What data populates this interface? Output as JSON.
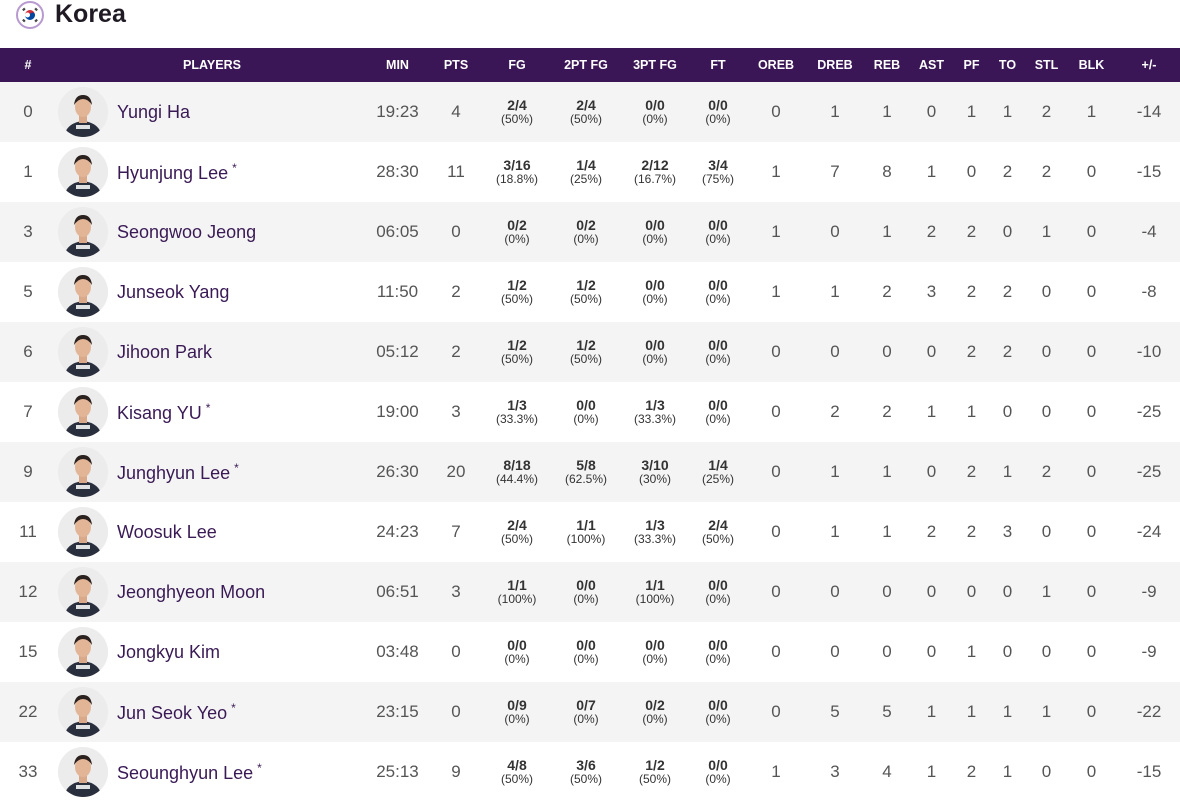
{
  "team": {
    "name": "Korea",
    "flag_icon": "korea-flag-icon"
  },
  "columns": [
    "#",
    "PLAYERS",
    "MIN",
    "PTS",
    "FG",
    "2PT FG",
    "3PT FG",
    "FT",
    "OREB",
    "DREB",
    "REB",
    "AST",
    "PF",
    "TO",
    "STL",
    "BLK",
    "+/-"
  ],
  "colors": {
    "header_bg": "#3b1656",
    "name_color": "#3a1a55",
    "row_alt": "#f4f4f4"
  },
  "players": [
    {
      "num": "0",
      "name": "Yungi Ha",
      "starter": false,
      "min": "19:23",
      "pts": "4",
      "fg": "2/4",
      "fg_pct": "(50%)",
      "fg2": "2/4",
      "fg2_pct": "(50%)",
      "fg3": "0/0",
      "fg3_pct": "(0%)",
      "ft": "0/0",
      "ft_pct": "(0%)",
      "oreb": "0",
      "dreb": "1",
      "reb": "1",
      "ast": "0",
      "pf": "1",
      "to": "1",
      "stl": "2",
      "blk": "1",
      "pm": "-14"
    },
    {
      "num": "1",
      "name": "Hyunjung Lee",
      "starter": true,
      "min": "28:30",
      "pts": "11",
      "fg": "3/16",
      "fg_pct": "(18.8%)",
      "fg2": "1/4",
      "fg2_pct": "(25%)",
      "fg3": "2/12",
      "fg3_pct": "(16.7%)",
      "ft": "3/4",
      "ft_pct": "(75%)",
      "oreb": "1",
      "dreb": "7",
      "reb": "8",
      "ast": "1",
      "pf": "0",
      "to": "2",
      "stl": "2",
      "blk": "0",
      "pm": "-15"
    },
    {
      "num": "3",
      "name": "Seongwoo Jeong",
      "starter": false,
      "min": "06:05",
      "pts": "0",
      "fg": "0/2",
      "fg_pct": "(0%)",
      "fg2": "0/2",
      "fg2_pct": "(0%)",
      "fg3": "0/0",
      "fg3_pct": "(0%)",
      "ft": "0/0",
      "ft_pct": "(0%)",
      "oreb": "1",
      "dreb": "0",
      "reb": "1",
      "ast": "2",
      "pf": "2",
      "to": "0",
      "stl": "1",
      "blk": "0",
      "pm": "-4"
    },
    {
      "num": "5",
      "name": "Junseok Yang",
      "starter": false,
      "min": "11:50",
      "pts": "2",
      "fg": "1/2",
      "fg_pct": "(50%)",
      "fg2": "1/2",
      "fg2_pct": "(50%)",
      "fg3": "0/0",
      "fg3_pct": "(0%)",
      "ft": "0/0",
      "ft_pct": "(0%)",
      "oreb": "1",
      "dreb": "1",
      "reb": "2",
      "ast": "3",
      "pf": "2",
      "to": "2",
      "stl": "0",
      "blk": "0",
      "pm": "-8"
    },
    {
      "num": "6",
      "name": "Jihoon Park",
      "starter": false,
      "min": "05:12",
      "pts": "2",
      "fg": "1/2",
      "fg_pct": "(50%)",
      "fg2": "1/2",
      "fg2_pct": "(50%)",
      "fg3": "0/0",
      "fg3_pct": "(0%)",
      "ft": "0/0",
      "ft_pct": "(0%)",
      "oreb": "0",
      "dreb": "0",
      "reb": "0",
      "ast": "0",
      "pf": "2",
      "to": "2",
      "stl": "0",
      "blk": "0",
      "pm": "-10"
    },
    {
      "num": "7",
      "name": "Kisang YU",
      "starter": true,
      "min": "19:00",
      "pts": "3",
      "fg": "1/3",
      "fg_pct": "(33.3%)",
      "fg2": "0/0",
      "fg2_pct": "(0%)",
      "fg3": "1/3",
      "fg3_pct": "(33.3%)",
      "ft": "0/0",
      "ft_pct": "(0%)",
      "oreb": "0",
      "dreb": "2",
      "reb": "2",
      "ast": "1",
      "pf": "1",
      "to": "0",
      "stl": "0",
      "blk": "0",
      "pm": "-25"
    },
    {
      "num": "9",
      "name": "Junghyun Lee",
      "starter": true,
      "min": "26:30",
      "pts": "20",
      "fg": "8/18",
      "fg_pct": "(44.4%)",
      "fg2": "5/8",
      "fg2_pct": "(62.5%)",
      "fg3": "3/10",
      "fg3_pct": "(30%)",
      "ft": "1/4",
      "ft_pct": "(25%)",
      "oreb": "0",
      "dreb": "1",
      "reb": "1",
      "ast": "0",
      "pf": "2",
      "to": "1",
      "stl": "2",
      "blk": "0",
      "pm": "-25"
    },
    {
      "num": "11",
      "name": "Woosuk Lee",
      "starter": false,
      "min": "24:23",
      "pts": "7",
      "fg": "2/4",
      "fg_pct": "(50%)",
      "fg2": "1/1",
      "fg2_pct": "(100%)",
      "fg3": "1/3",
      "fg3_pct": "(33.3%)",
      "ft": "2/4",
      "ft_pct": "(50%)",
      "oreb": "0",
      "dreb": "1",
      "reb": "1",
      "ast": "2",
      "pf": "2",
      "to": "3",
      "stl": "0",
      "blk": "0",
      "pm": "-24"
    },
    {
      "num": "12",
      "name": "Jeonghyeon Moon",
      "starter": false,
      "min": "06:51",
      "pts": "3",
      "fg": "1/1",
      "fg_pct": "(100%)",
      "fg2": "0/0",
      "fg2_pct": "(0%)",
      "fg3": "1/1",
      "fg3_pct": "(100%)",
      "ft": "0/0",
      "ft_pct": "(0%)",
      "oreb": "0",
      "dreb": "0",
      "reb": "0",
      "ast": "0",
      "pf": "0",
      "to": "0",
      "stl": "1",
      "blk": "0",
      "pm": "-9"
    },
    {
      "num": "15",
      "name": "Jongkyu Kim",
      "starter": false,
      "min": "03:48",
      "pts": "0",
      "fg": "0/0",
      "fg_pct": "(0%)",
      "fg2": "0/0",
      "fg2_pct": "(0%)",
      "fg3": "0/0",
      "fg3_pct": "(0%)",
      "ft": "0/0",
      "ft_pct": "(0%)",
      "oreb": "0",
      "dreb": "0",
      "reb": "0",
      "ast": "0",
      "pf": "1",
      "to": "0",
      "stl": "0",
      "blk": "0",
      "pm": "-9"
    },
    {
      "num": "22",
      "name": "Jun Seok Yeo",
      "starter": true,
      "min": "23:15",
      "pts": "0",
      "fg": "0/9",
      "fg_pct": "(0%)",
      "fg2": "0/7",
      "fg2_pct": "(0%)",
      "fg3": "0/2",
      "fg3_pct": "(0%)",
      "ft": "0/0",
      "ft_pct": "(0%)",
      "oreb": "0",
      "dreb": "5",
      "reb": "5",
      "ast": "1",
      "pf": "1",
      "to": "1",
      "stl": "1",
      "blk": "0",
      "pm": "-22"
    },
    {
      "num": "33",
      "name": "Seounghyun Lee",
      "starter": true,
      "min": "25:13",
      "pts": "9",
      "fg": "4/8",
      "fg_pct": "(50%)",
      "fg2": "3/6",
      "fg2_pct": "(50%)",
      "fg3": "1/2",
      "fg3_pct": "(50%)",
      "ft": "0/0",
      "ft_pct": "(0%)",
      "oreb": "1",
      "dreb": "3",
      "reb": "4",
      "ast": "1",
      "pf": "2",
      "to": "1",
      "stl": "0",
      "blk": "0",
      "pm": "-15"
    }
  ],
  "starter_mark": "*"
}
